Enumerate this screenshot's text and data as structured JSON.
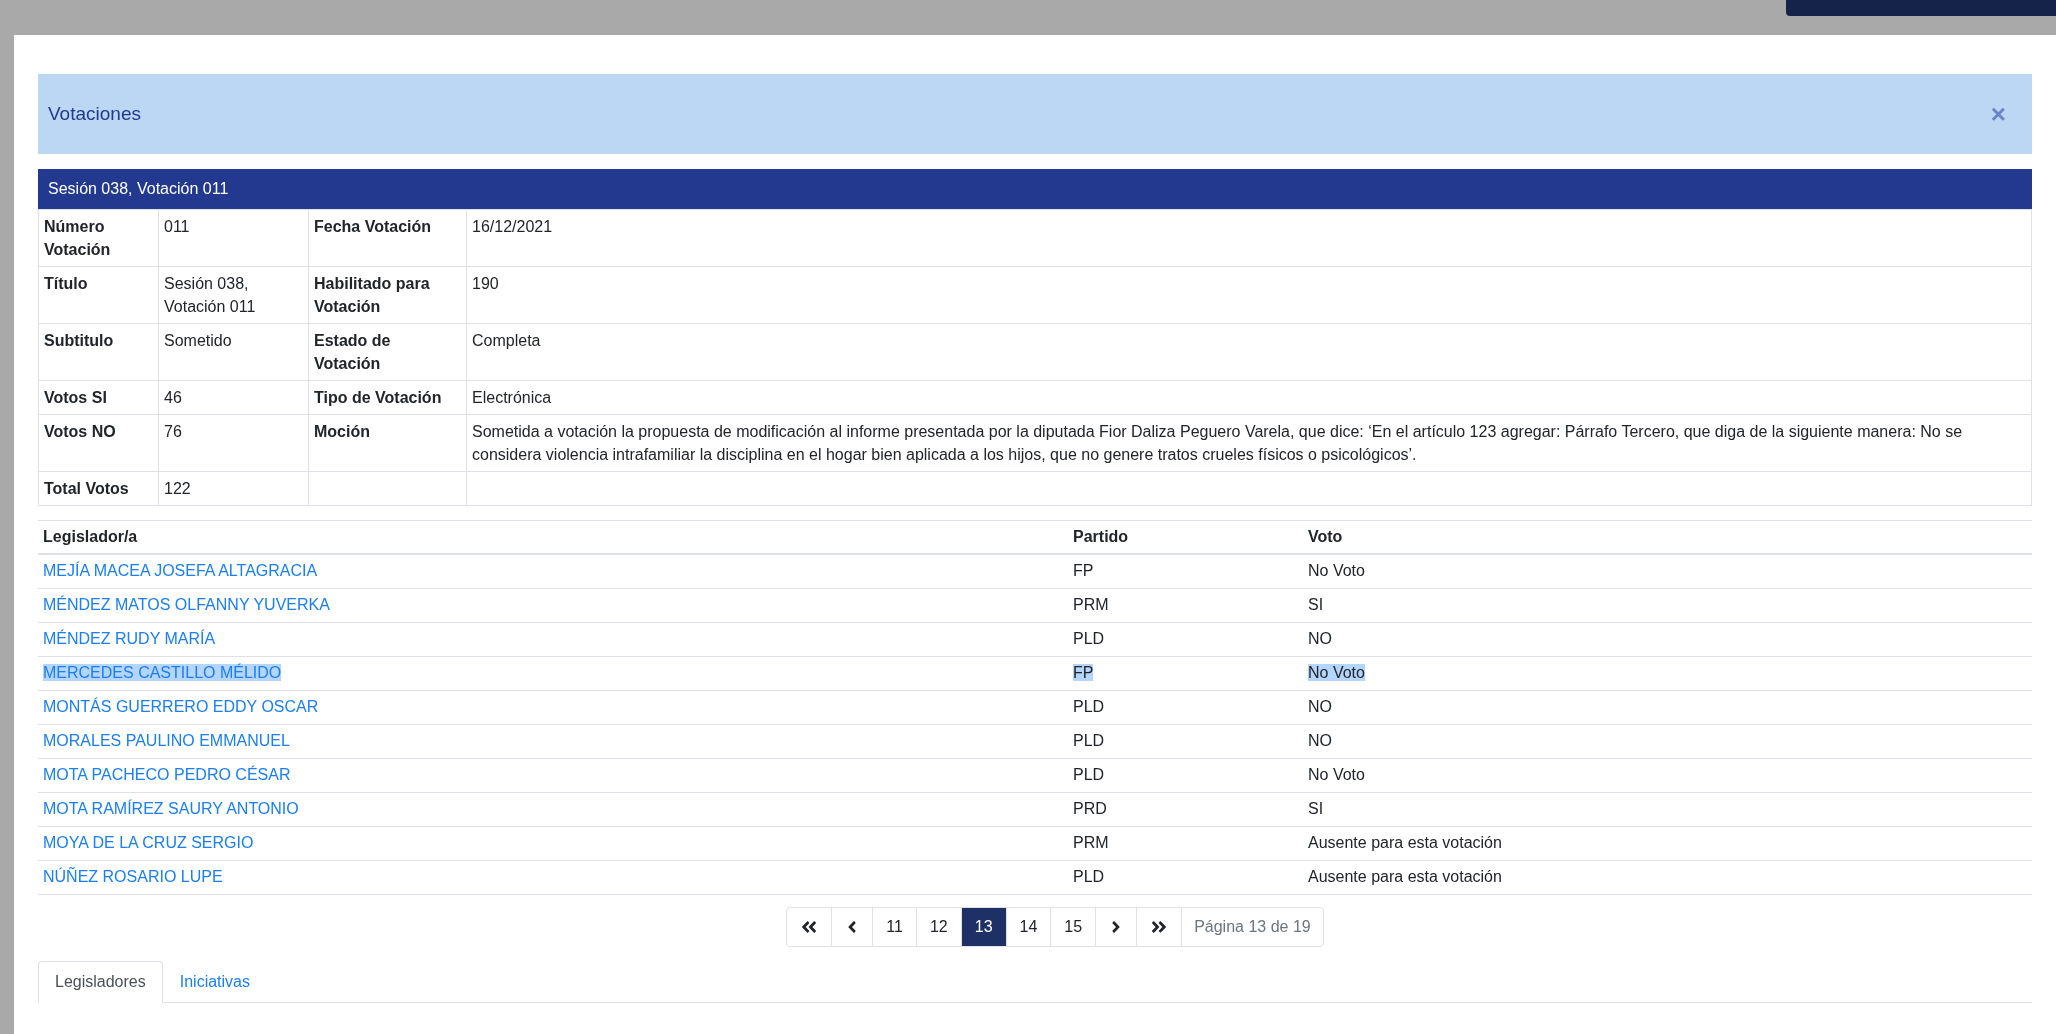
{
  "modal": {
    "title": "Votaciones",
    "close": "×"
  },
  "session": {
    "heading": "Sesión 038, Votación 011",
    "details": [
      {
        "label1": "Número Votación",
        "value1": "011",
        "label2": "Fecha Votación",
        "value2": "16/12/2021"
      },
      {
        "label1": "Título",
        "value1": "Sesión 038, Votación 011",
        "label2": "Habilitado para Votación",
        "value2": "190"
      },
      {
        "label1": "Subtitulo",
        "value1": "Sometido",
        "label2": "Estado de Votación",
        "value2": "Completa"
      },
      {
        "label1": "Votos SI",
        "value1": "46",
        "label2": "Tipo de Votación",
        "value2": "Electrónica"
      },
      {
        "label1": "Votos NO",
        "value1": "76",
        "label2": "Moción",
        "value2": "Sometida a votación la propuesta de modificación al informe presentada por la diputada Fior Daliza Peguero Varela, que dice: ‘En el artículo 123 agregar: Párrafo Tercero, que diga de la siguiente manera: No se considera violencia intrafamiliar la disciplina en el hogar bien aplicada a los hijos, que no genere tratos crueles físicos o psicológicos’."
      },
      {
        "label1": "Total Votos",
        "value1": "122"
      }
    ]
  },
  "votes": {
    "columns": [
      "Legislador/a",
      "Partido",
      "Voto"
    ],
    "rows": [
      {
        "name": "MEJÍA MACEA JOSEFA ALTAGRACIA",
        "party": "FP",
        "vote": "No Voto",
        "selected": false
      },
      {
        "name": "MÉNDEZ MATOS OLFANNY YUVERKA",
        "party": "PRM",
        "vote": "SI",
        "selected": false
      },
      {
        "name": "MÉNDEZ RUDY MARÍA",
        "party": "PLD",
        "vote": "NO",
        "selected": false
      },
      {
        "name": "MERCEDES CASTILLO MÉLIDO",
        "party": "FP",
        "vote": "No Voto",
        "selected": true
      },
      {
        "name": "MONTÁS GUERRERO EDDY OSCAR",
        "party": "PLD",
        "vote": "NO",
        "selected": false
      },
      {
        "name": "MORALES PAULINO EMMANUEL",
        "party": "PLD",
        "vote": "NO",
        "selected": false
      },
      {
        "name": "MOTA PACHECO PEDRO CÉSAR",
        "party": "PLD",
        "vote": "No Voto",
        "selected": false
      },
      {
        "name": "MOTA RAMÍREZ SAURY ANTONIO",
        "party": "PRD",
        "vote": "SI",
        "selected": false
      },
      {
        "name": "MOYA DE LA CRUZ SERGIO",
        "party": "PRM",
        "vote": "Ausente para esta votación",
        "selected": false
      },
      {
        "name": "NÚÑEZ ROSARIO LUPE",
        "party": "PLD",
        "vote": "Ausente para esta votación",
        "selected": false
      }
    ]
  },
  "pagination": {
    "pages": [
      {
        "label": "11",
        "selected": false
      },
      {
        "label": "12",
        "selected": false
      },
      {
        "label": "13",
        "selected": true
      },
      {
        "label": "14",
        "selected": false
      },
      {
        "label": "15",
        "selected": false
      }
    ],
    "info": "Página 13 de 19"
  },
  "tabs": [
    {
      "label": "Legisladores",
      "selected": true
    },
    {
      "label": "Iniciativas",
      "selected": false
    }
  ]
}
